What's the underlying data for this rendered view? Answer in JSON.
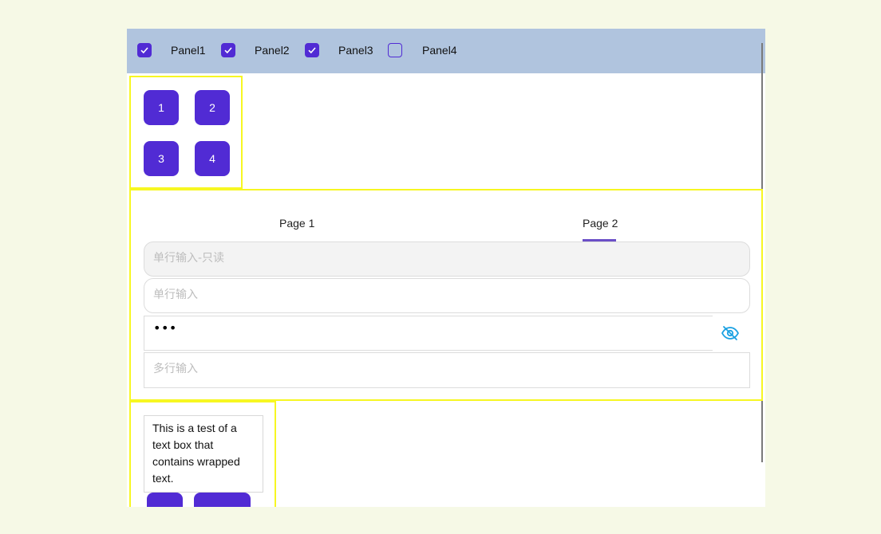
{
  "panels_bar": {
    "items": [
      {
        "label": "Panel1",
        "checked": true
      },
      {
        "label": "Panel2",
        "checked": true
      },
      {
        "label": "Panel3",
        "checked": true
      },
      {
        "label": "Panel4",
        "checked": false
      }
    ]
  },
  "grid_panel": {
    "tiles": [
      "1",
      "2",
      "3",
      "4"
    ]
  },
  "tabs_panel": {
    "tabs": [
      {
        "label": "Page 1",
        "selected": false
      },
      {
        "label": "Page 2",
        "selected": true
      }
    ],
    "readonly_input": {
      "placeholder": "单行输入-只读"
    },
    "single_input": {
      "placeholder": "单行输入"
    },
    "password_input": {
      "value": "•••"
    },
    "multiline_input": {
      "placeholder": "多行输入"
    }
  },
  "text_panel": {
    "wrapped_text": "This is a test of a text box that contains wrapped text."
  },
  "colors": {
    "accent": "#512bd4",
    "topbar": "#b0c4de",
    "panel_border": "#f7f722",
    "tab_indicator": "#6b4fc7",
    "eye_icon": "#1ba1e2"
  }
}
